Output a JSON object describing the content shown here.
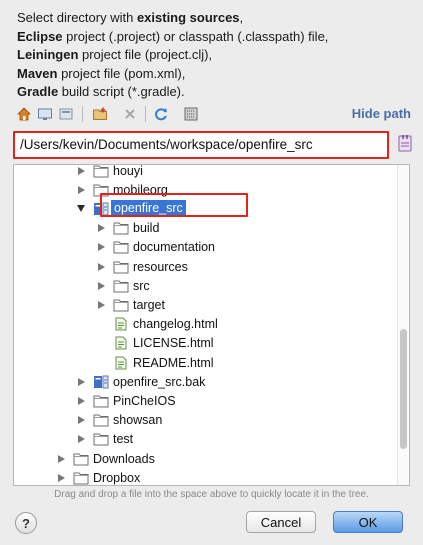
{
  "description": {
    "line1_prefix": "Select directory with ",
    "line1_bold": "existing sources",
    "line1_suffix": ",",
    "line2_bold": "Eclipse",
    "line2_rest": " project (.project) or classpath (.classpath) file,",
    "line3_bold": "Leiningen",
    "line3_rest": " project file (project.clj),",
    "line4_bold": "Maven",
    "line4_rest": " project file (pom.xml),",
    "line5_bold": "Gradle",
    "line5_rest": " build script (*.gradle)."
  },
  "toolbar": {
    "hide_path_label": "Hide path"
  },
  "path_field": {
    "value": "/Users/kevin/Documents/workspace/openfire_src"
  },
  "tree": {
    "items": [
      {
        "label": "houyi",
        "indent": 1,
        "expander": "right",
        "icon": "folder"
      },
      {
        "label": "mobileorg",
        "indent": 1,
        "expander": "right",
        "icon": "folder"
      },
      {
        "label": "openfire_src",
        "indent": 1,
        "expander": "down",
        "icon": "module",
        "selected": true
      },
      {
        "label": "build",
        "indent": 2,
        "expander": "right",
        "icon": "folder"
      },
      {
        "label": "documentation",
        "indent": 2,
        "expander": "right",
        "icon": "folder"
      },
      {
        "label": "resources",
        "indent": 2,
        "expander": "right",
        "icon": "folder"
      },
      {
        "label": "src",
        "indent": 2,
        "expander": "right",
        "icon": "folder"
      },
      {
        "label": "target",
        "indent": 2,
        "expander": "right",
        "icon": "folder"
      },
      {
        "label": "changelog.html",
        "indent": 2,
        "expander": "none",
        "icon": "html"
      },
      {
        "label": "LICENSE.html",
        "indent": 2,
        "expander": "none",
        "icon": "html"
      },
      {
        "label": "README.html",
        "indent": 2,
        "expander": "none",
        "icon": "html"
      },
      {
        "label": "openfire_src.bak",
        "indent": 1,
        "expander": "right",
        "icon": "module"
      },
      {
        "label": "PinCheIOS",
        "indent": 1,
        "expander": "right",
        "icon": "folder"
      },
      {
        "label": "showsan",
        "indent": 1,
        "expander": "right",
        "icon": "folder"
      },
      {
        "label": "test",
        "indent": 1,
        "expander": "right",
        "icon": "folder"
      },
      {
        "label": "Downloads",
        "indent": 0,
        "expander": "right",
        "icon": "folder"
      },
      {
        "label": "Dropbox",
        "indent": 0,
        "expander": "right",
        "icon": "folder"
      }
    ]
  },
  "hint": "Drag and drop a file into the space above to quickly locate it in the tree.",
  "buttons": {
    "help": "?",
    "cancel": "Cancel",
    "ok": "OK"
  }
}
